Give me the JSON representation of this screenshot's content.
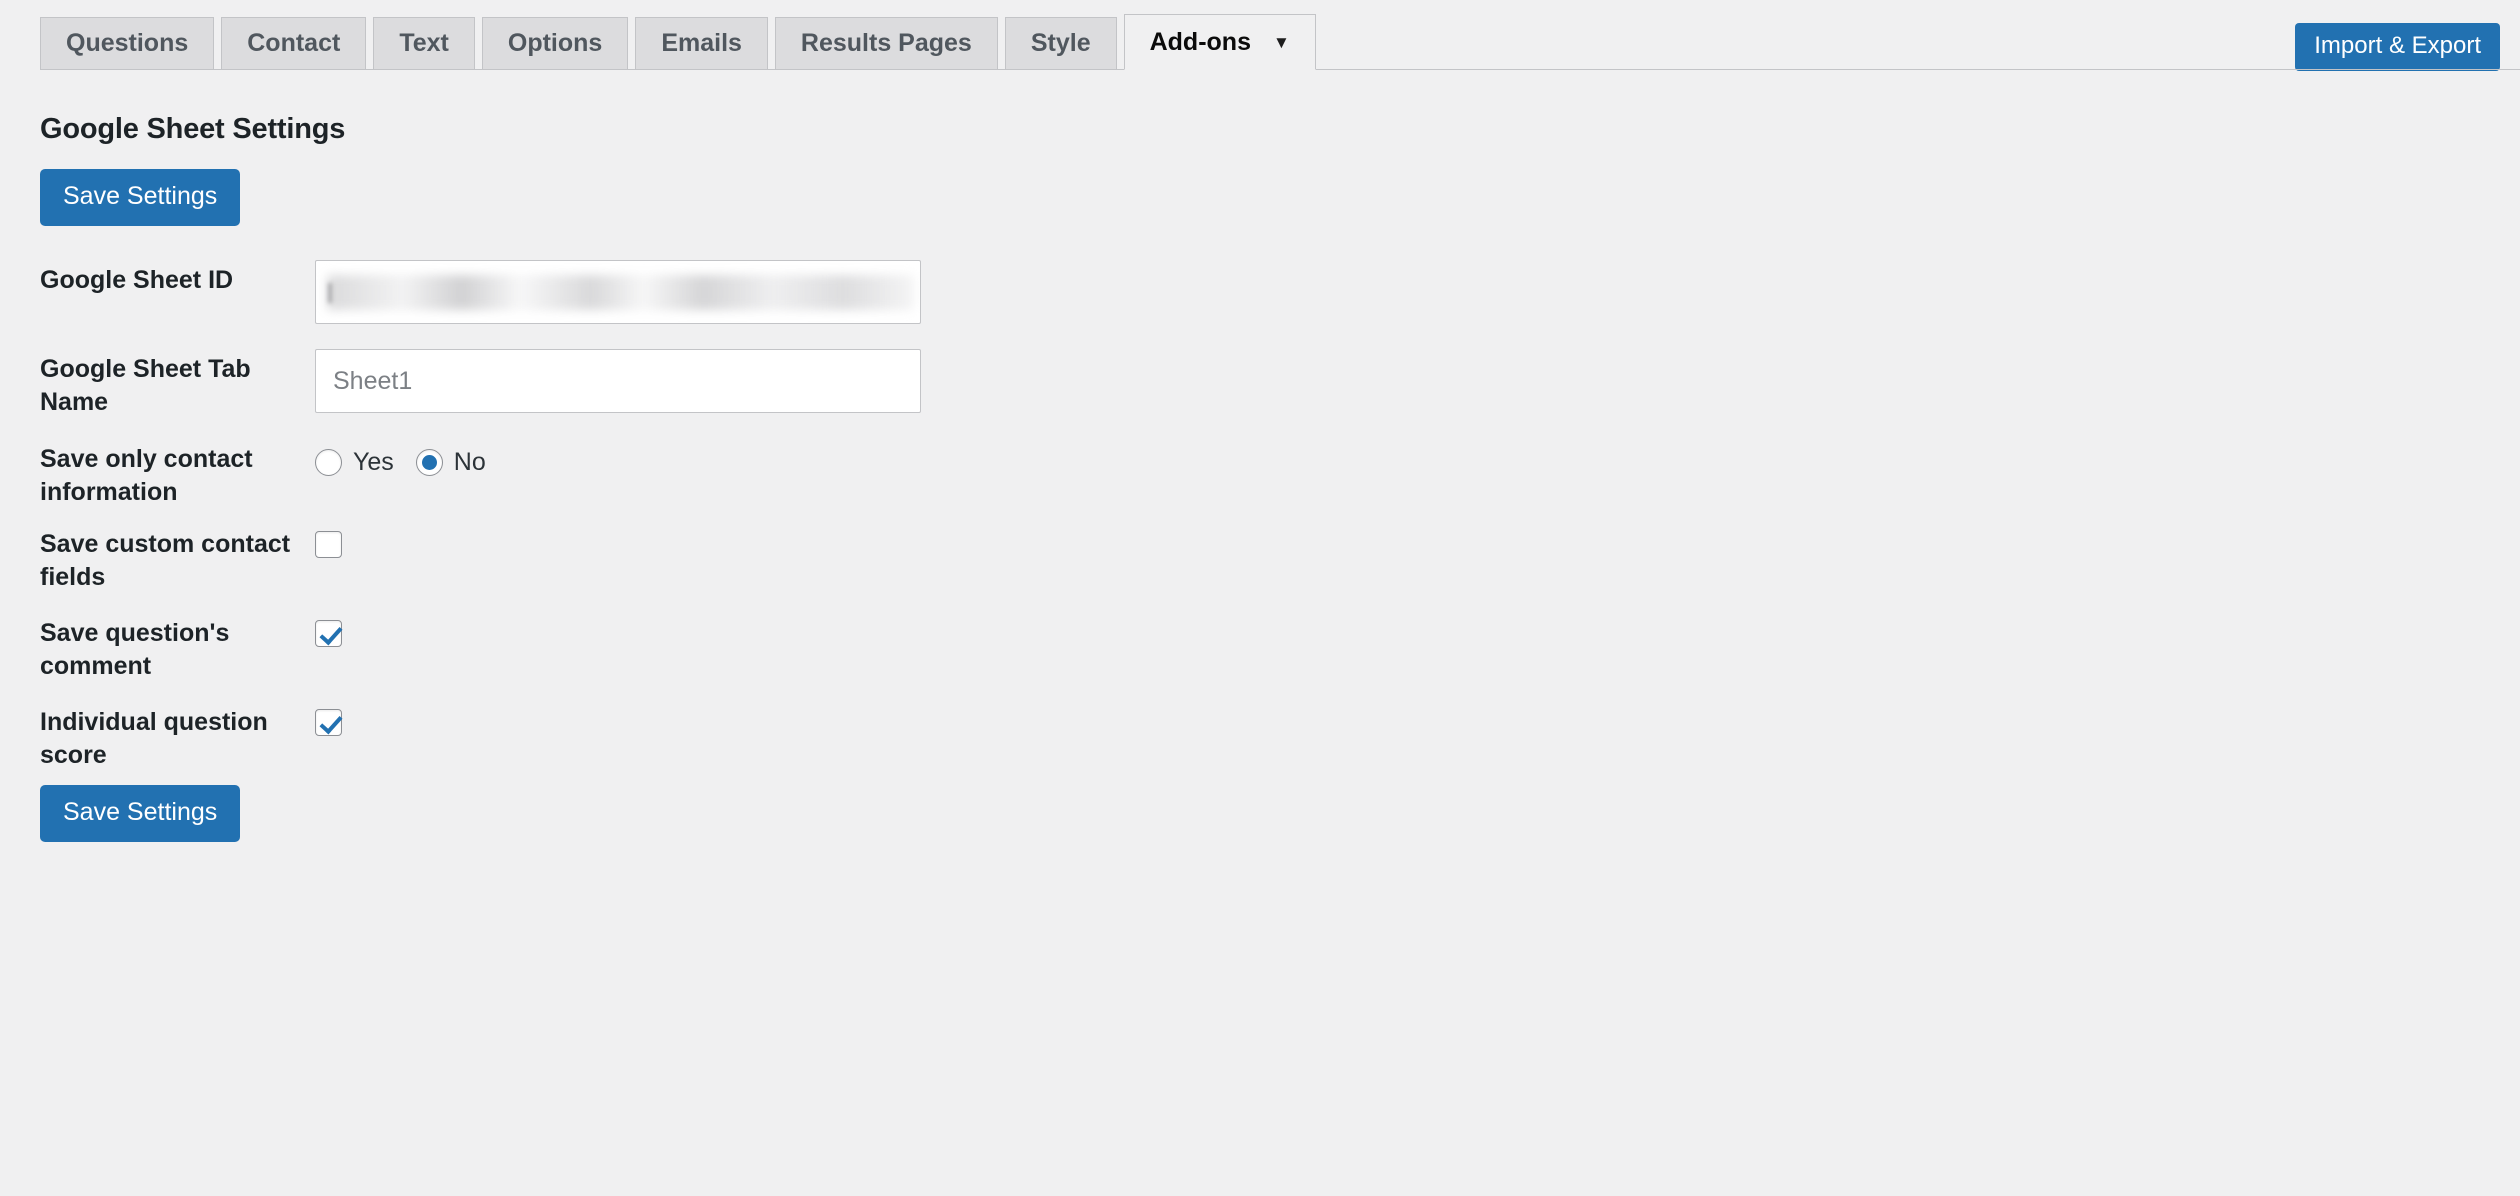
{
  "tabs": [
    {
      "label": "Questions",
      "active": false,
      "caret": false
    },
    {
      "label": "Contact",
      "active": false,
      "caret": false
    },
    {
      "label": "Text",
      "active": false,
      "caret": false
    },
    {
      "label": "Options",
      "active": false,
      "caret": false
    },
    {
      "label": "Emails",
      "active": false,
      "caret": false
    },
    {
      "label": "Results Pages",
      "active": false,
      "caret": false
    },
    {
      "label": "Style",
      "active": false,
      "caret": false
    },
    {
      "label": "Add-ons",
      "active": true,
      "caret": true,
      "caret_glyph": "▼"
    }
  ],
  "header": {
    "import_export_label": "Import & Export"
  },
  "main": {
    "title": "Google Sheet Settings",
    "save_top_label": "Save Settings",
    "save_bottom_label": "Save Settings",
    "fields": {
      "sheet_id": {
        "label": "Google Sheet ID",
        "value": "",
        "redacted": true
      },
      "tab_name": {
        "label": "Google Sheet Tab Name",
        "value": "Sheet1",
        "placeholder": "Sheet1"
      },
      "save_only_contact": {
        "label": "Save only contact information",
        "options": [
          {
            "label": "Yes",
            "selected": false
          },
          {
            "label": "No",
            "selected": true
          }
        ]
      },
      "save_custom_fields": {
        "label": "Save custom contact fields",
        "checked": false
      },
      "save_question_comment": {
        "label": "Save question's comment",
        "checked": true
      },
      "individual_question_score": {
        "label": "Individual question score",
        "checked": true
      }
    }
  },
  "colors": {
    "accent": "#2271b1",
    "page_bg": "#f0f0f1",
    "tab_bg": "#dcdcde",
    "tab_border": "#c3c4c7",
    "text_dark": "#1d2327",
    "text_muted": "#50575e"
  }
}
